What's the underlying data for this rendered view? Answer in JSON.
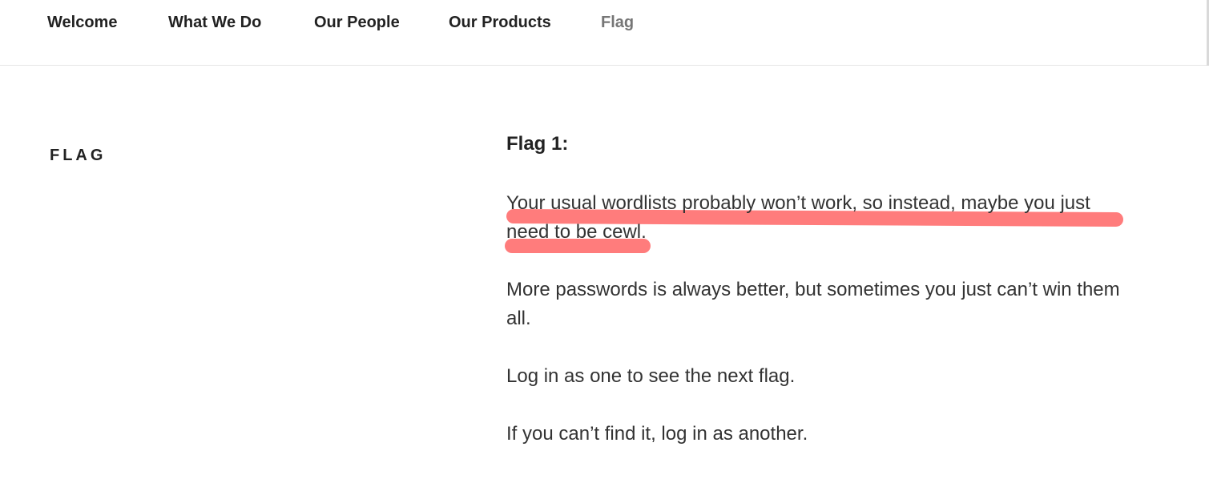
{
  "nav": {
    "items": [
      {
        "label": "Welcome",
        "current": false
      },
      {
        "label": "What We Do",
        "current": false
      },
      {
        "label": "Our People",
        "current": false
      },
      {
        "label": "Our Products",
        "current": false
      },
      {
        "label": "Flag",
        "current": true
      }
    ]
  },
  "page": {
    "title": "Flag"
  },
  "content": {
    "heading": "Flag 1:",
    "paragraphs": [
      "Your usual wordlists probably won’t work, so instead, maybe you just need to be cewl.",
      "More passwords is always better, but sometimes you just can’t win them all.",
      "Log in as one to see the next flag.",
      "If you can’t find it, log in as another."
    ],
    "highlight_color": "#ff7a7a"
  },
  "colors": {
    "text": "#222222",
    "current_nav": "#767676",
    "body_text": "#333333"
  }
}
